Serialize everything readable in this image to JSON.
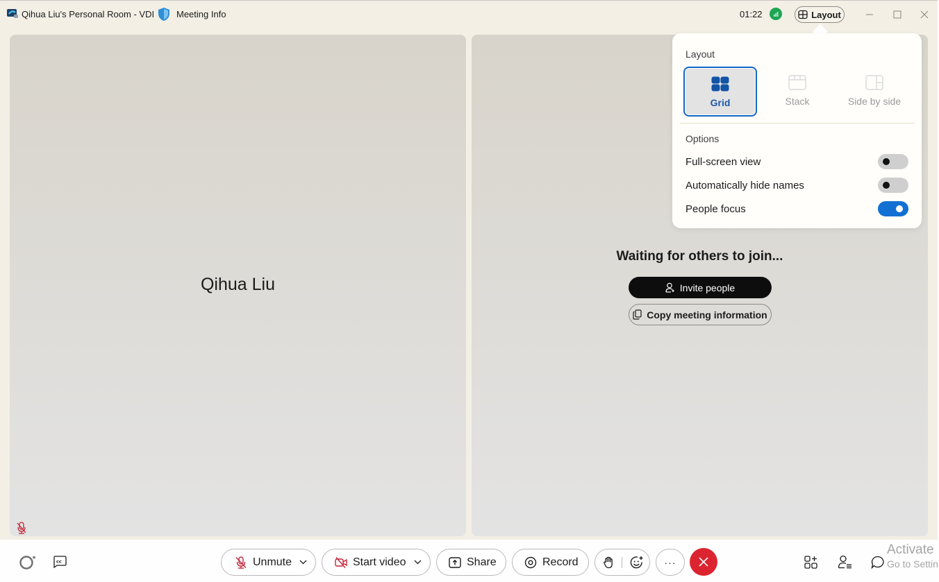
{
  "titlebar": {
    "app_title": "Qihua Liu's Personal Room - VDI",
    "meeting_info": "Meeting Info",
    "timer": "01:22",
    "layout_button": "Layout"
  },
  "tiles": {
    "self_name": "Qihua Liu",
    "waiting_text": "Waiting for others to join...",
    "invite_button": "Invite people",
    "copy_button": "Copy meeting information"
  },
  "layout_popover": {
    "title": "Layout",
    "options": [
      {
        "label": "Grid",
        "icon": "grid-layout-icon",
        "selected": true
      },
      {
        "label": "Stack",
        "icon": "stack-layout-icon",
        "selected": false
      },
      {
        "label": "Side by side",
        "icon": "side-by-side-layout-icon",
        "selected": false
      }
    ],
    "options_title": "Options",
    "toggles": [
      {
        "label": "Full-screen view",
        "on": false
      },
      {
        "label": "Automatically hide names",
        "on": false
      },
      {
        "label": "People focus",
        "on": true
      }
    ]
  },
  "toolbar": {
    "unmute": "Unmute",
    "start_video": "Start video",
    "share": "Share",
    "record": "Record",
    "more": "···"
  },
  "watermark": {
    "line1": "Activate",
    "line2": "Go to Settin"
  },
  "colors": {
    "accent": "#1270d3",
    "end_call": "#dc2430",
    "muted": "#c4253a",
    "signal": "#1da553"
  }
}
